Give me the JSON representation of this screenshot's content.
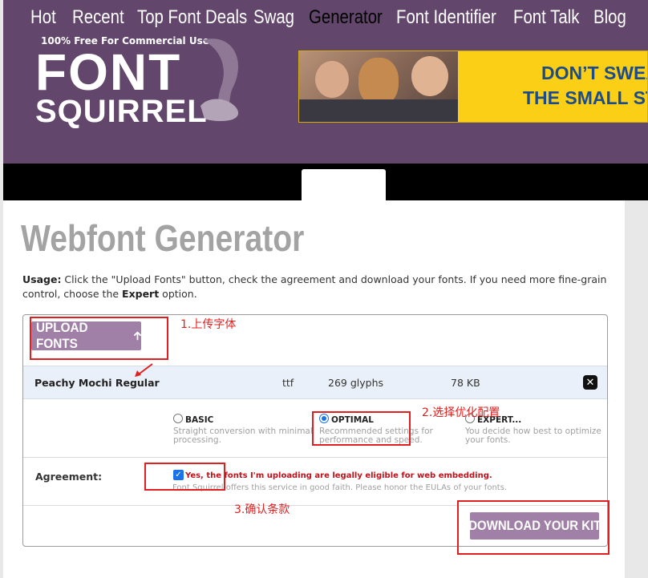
{
  "header": {
    "tagline": "100% Free For Commercial Use.",
    "logo_line1": "FONT",
    "logo_line2": "SQUIRREL",
    "ad_line1": "DON’T SWEA",
    "ad_line2": "THE SMALL ST"
  },
  "nav": {
    "items": [
      "Hot",
      "Recent",
      "Top Font Deals",
      "Swag",
      "Generator",
      "Font Identifier",
      "Font Talk",
      "Blog"
    ],
    "active": "Generator"
  },
  "page": {
    "title": "Webfont Generator",
    "usage_label": "Usage:",
    "usage_text_1": " Click the \"Upload Fonts\" button, check the agreement and download your fonts. If you need more fine-grain control, choose the ",
    "usage_expert": "Expert",
    "usage_text_2": " option."
  },
  "upload": {
    "label": "UPLOAD FONTS",
    "icon": "arrow-up-icon"
  },
  "font_file": {
    "name": "Peachy Mochi Regular",
    "format": "ttf",
    "glyphs": "269 glyphs",
    "size": "78 KB"
  },
  "options": [
    {
      "name": "BASIC",
      "desc": "Straight conversion with minimal processing.",
      "selected": false
    },
    {
      "name": "OPTIMAL",
      "desc": "Recommended settings for performance and speed.",
      "selected": true
    },
    {
      "name": "EXPERT...",
      "desc": "You decide how best to optimize your fonts.",
      "selected": false
    }
  ],
  "agreement": {
    "label": "Agreement:",
    "checked": true,
    "text": "Yes, the fonts I'm uploading are legally eligible for web embedding.",
    "note": "Font Squirrel offers this service in good faith. Please honor the EULAs of your fonts."
  },
  "download": {
    "label": "DOWNLOAD YOUR KIT"
  },
  "annotations": {
    "step1": "1.上传字体",
    "step2": "2.选择优化配置",
    "step3": "3.确认条款",
    "color": "#e02020"
  },
  "colors": {
    "header_bg": "#62466b",
    "button_bg": "#a180a8",
    "nav_bg": "#000000",
    "title": "#a3a3a3",
    "warning": "#c0111a"
  }
}
